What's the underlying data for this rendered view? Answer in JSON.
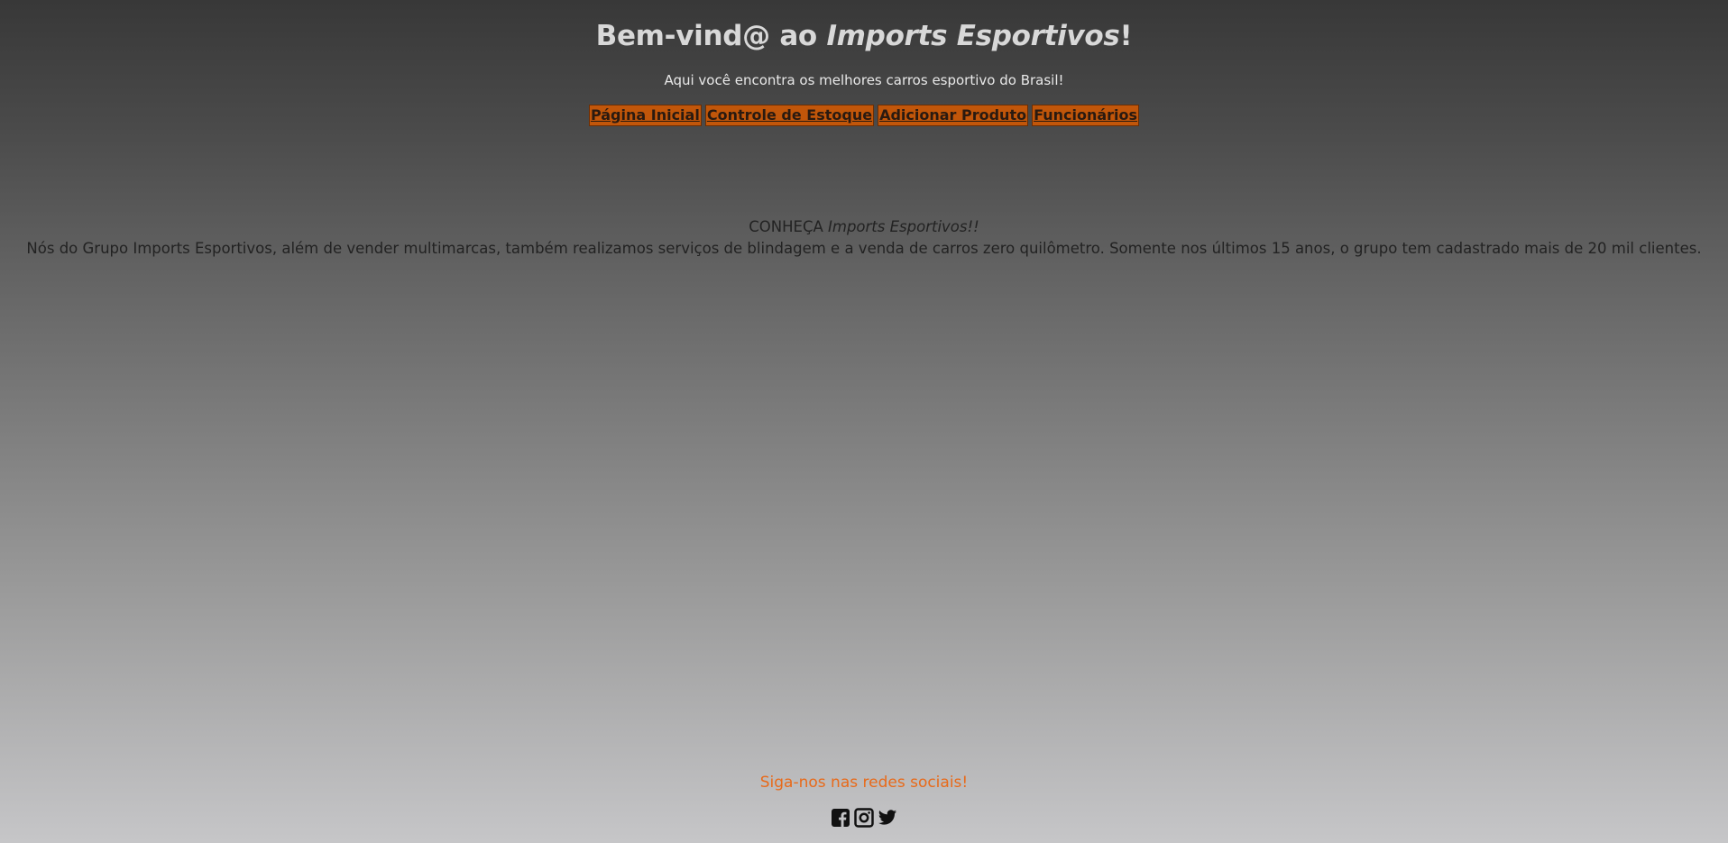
{
  "header": {
    "title_prefix": "Bem-vind@ ao ",
    "title_brand": "Imports Esportivos",
    "title_suffix": "!",
    "subtitle": "Aqui você encontra os melhores carros esportivo do Brasil!"
  },
  "nav": {
    "items": [
      {
        "label": "Página Inicial"
      },
      {
        "label": "Controle de Estoque"
      },
      {
        "label": "Adicionar Produto"
      },
      {
        "label": "Funcionários"
      }
    ],
    "accent_color": "#c1560a"
  },
  "about": {
    "heading_prefix": "CONHEÇA ",
    "heading_brand": "Imports Esportivos!!",
    "body": "Nós do Grupo Imports Esportivos, além de vender multimarcas, também realizamos serviços de blindagem e a venda de carros zero quilômetro. Somente nos últimos 15 anos, o grupo tem cadastrado mais de 20 mil clientes."
  },
  "footer": {
    "follow_text": "Siga-nos nas redes sociais!",
    "follow_color": "#e86a1a",
    "social_icons": [
      "facebook-icon",
      "instagram-icon",
      "twitter-icon"
    ]
  }
}
